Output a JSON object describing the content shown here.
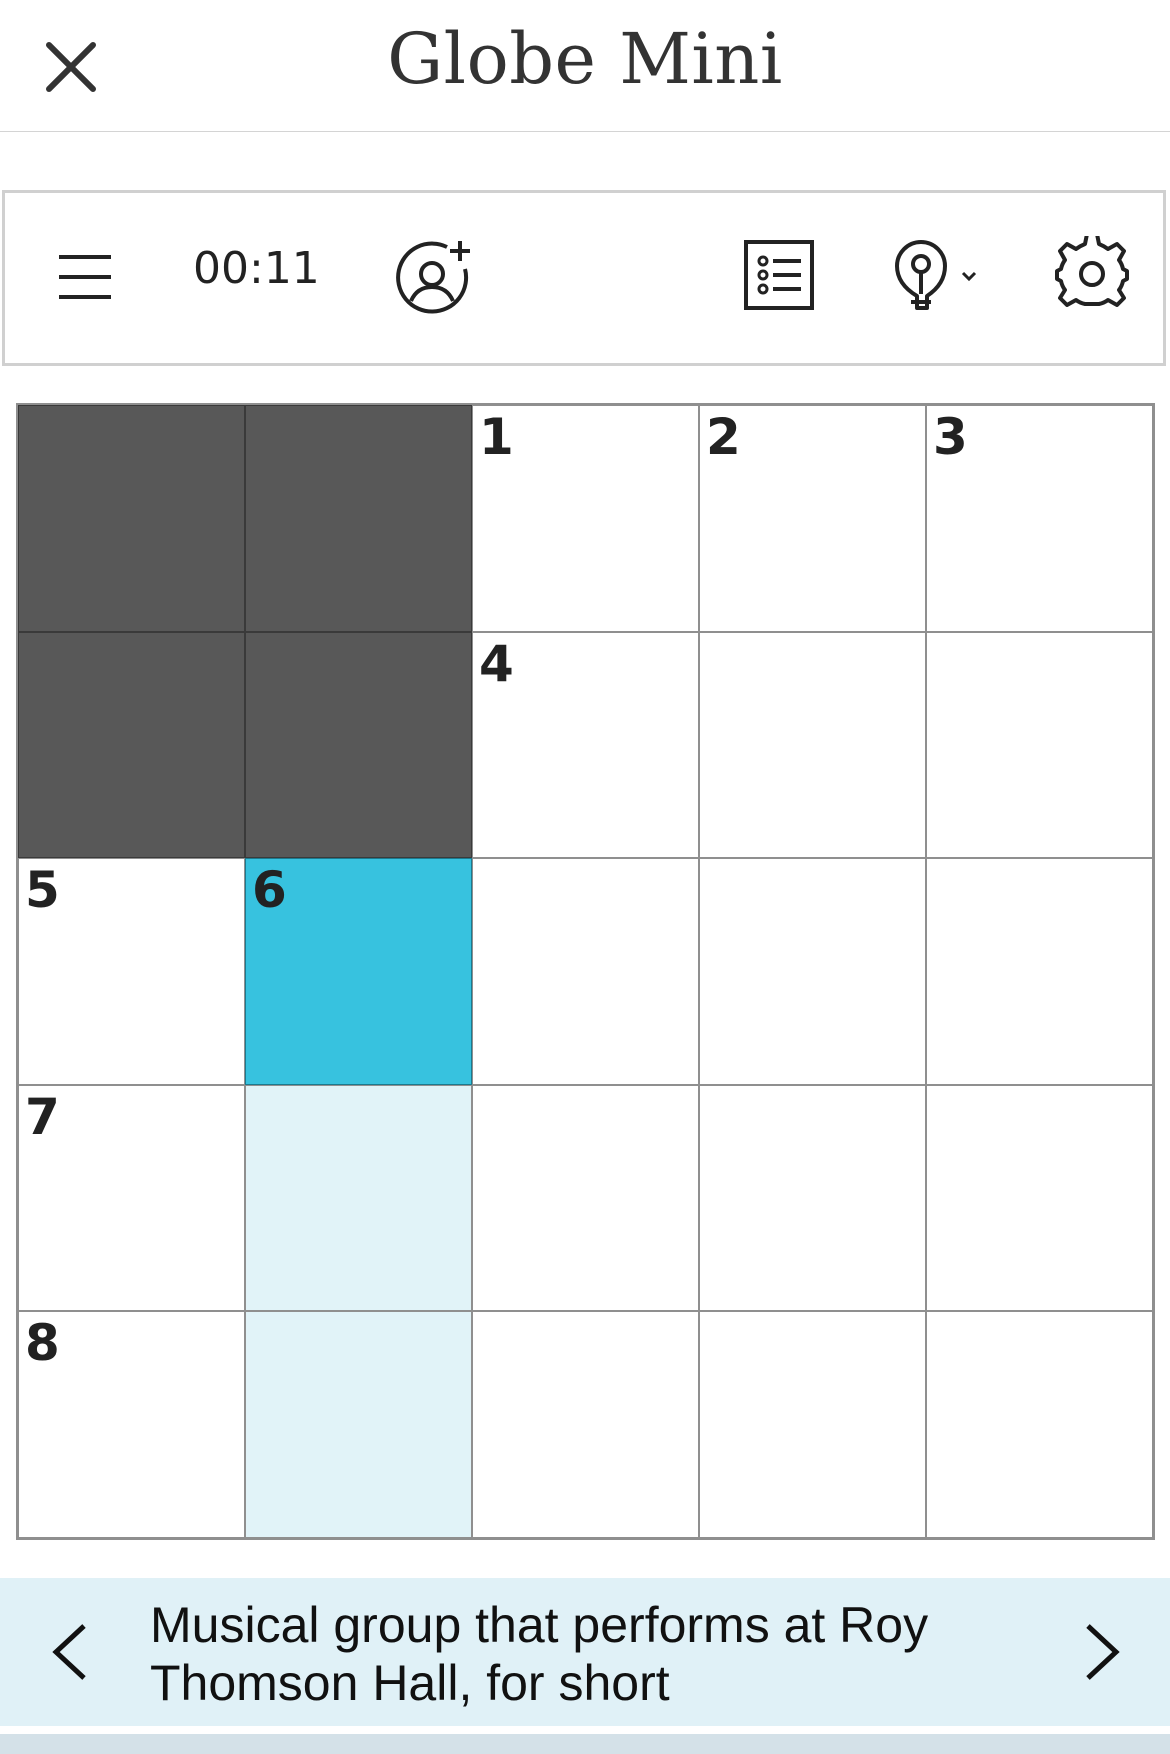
{
  "header": {
    "title": "Globe Mini",
    "close_icon": "close-icon"
  },
  "toolbar": {
    "menu_icon": "hamburger-menu-icon",
    "timer": "00:11",
    "invite_icon": "add-user-icon",
    "clues_list_icon": "list-icon",
    "hint_icon": "lightbulb-icon",
    "settings_icon": "gear-icon"
  },
  "grid": {
    "size": 5,
    "cells": [
      {
        "block": true,
        "num": ""
      },
      {
        "block": true,
        "num": ""
      },
      {
        "block": false,
        "num": "1"
      },
      {
        "block": false,
        "num": "2"
      },
      {
        "block": false,
        "num": "3"
      },
      {
        "block": true,
        "num": ""
      },
      {
        "block": true,
        "num": ""
      },
      {
        "block": false,
        "num": "4"
      },
      {
        "block": false,
        "num": ""
      },
      {
        "block": false,
        "num": ""
      },
      {
        "block": false,
        "num": "5"
      },
      {
        "block": false,
        "num": "6",
        "state": "active"
      },
      {
        "block": false,
        "num": ""
      },
      {
        "block": false,
        "num": ""
      },
      {
        "block": false,
        "num": ""
      },
      {
        "block": false,
        "num": "7"
      },
      {
        "block": false,
        "num": "",
        "state": "word"
      },
      {
        "block": false,
        "num": ""
      },
      {
        "block": false,
        "num": ""
      },
      {
        "block": false,
        "num": ""
      },
      {
        "block": false,
        "num": "8"
      },
      {
        "block": false,
        "num": "",
        "state": "word"
      },
      {
        "block": false,
        "num": ""
      },
      {
        "block": false,
        "num": ""
      },
      {
        "block": false,
        "num": ""
      }
    ]
  },
  "clue": {
    "text": "Musical group that performs at Roy Thomson Hall, for short",
    "prev_icon": "chevron-left-icon",
    "next_icon": "chevron-right-icon"
  },
  "colors": {
    "block": "#585858",
    "active": "#37c2df",
    "word_highlight": "#e1f3f8",
    "clue_bar": "#e0f1f7"
  }
}
